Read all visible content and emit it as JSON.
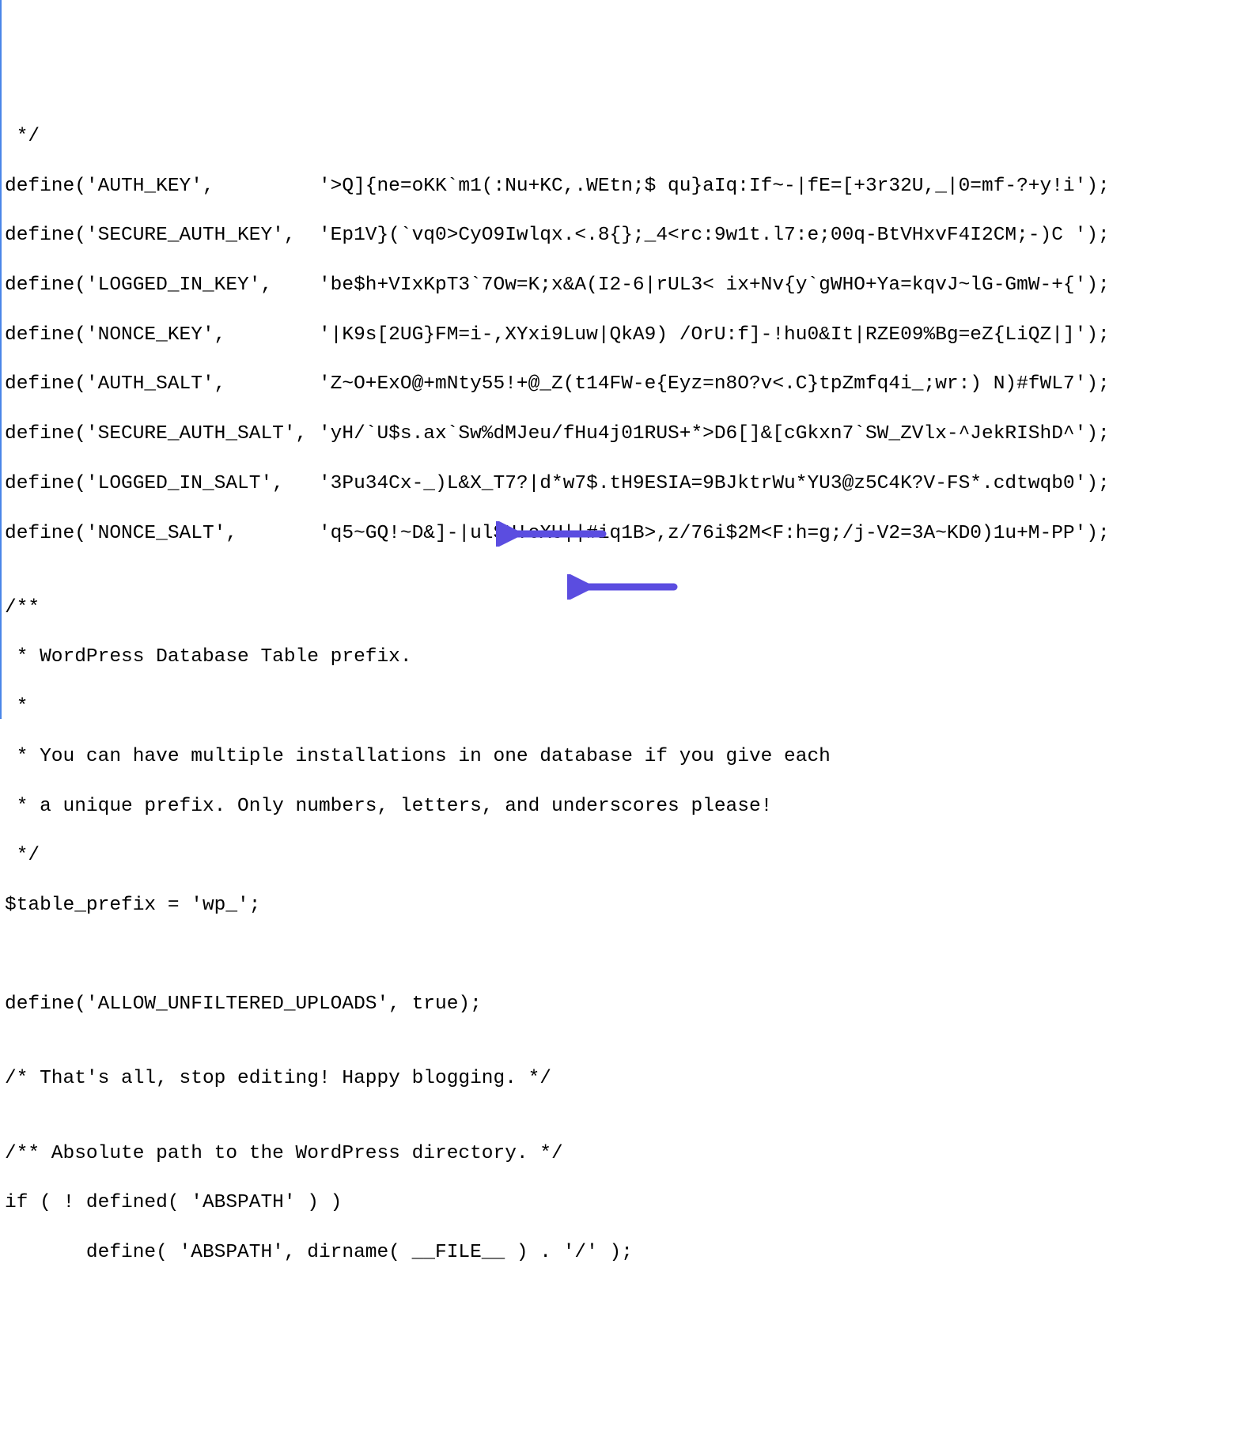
{
  "lines": {
    "l0": " */",
    "l1": "define('AUTH_KEY',         '>Q]{ne=oKK`m1(:Nu+KC,.WEtn;$ qu}aIq:If~-|fE=[+3r32U,_|0=mf-?+y!i');",
    "l2": "define('SECURE_AUTH_KEY',  'Ep1V}(`vq0>CyO9Iwlqx.<.8{};_4<rc:9w1t.l7:e;00q-BtVHxvF4I2CM;-)C ');",
    "l3": "define('LOGGED_IN_KEY',    'be$h+VIxKpT3`7Ow=K;x&A(I2-6|rUL3< ix+Nv{y`gWHO+Ya=kqvJ~lG-GmW-+{');",
    "l4": "define('NONCE_KEY',        '|K9s[2UG}FM=i-,XYxi9Luw|QkA9) /OrU:f]-!hu0&It|RZE09%Bg=eZ{LiQZ|]');",
    "l5": "define('AUTH_SALT',        'Z~O+ExO@+mNty55!+@_Z(t14FW-e{Eyz=n8O?v<.C}tpZmfq4i_;wr:) N)#fWL7');",
    "l6": "define('SECURE_AUTH_SALT', 'yH/`U$s.ax`Sw%dMJeu/fHu4j01RUS+*>D6[]&[cGkxn7`SW_ZVlx-^JekRIShD^');",
    "l7": "define('LOGGED_IN_SALT',   '3Pu34Cx-_)L&X_T7?|d*w7$.tH9ESIA=9BJktrWu*YU3@z5C4K?V-FS*.cdtwqb0');",
    "l8": "define('NONCE_SALT',       'q5~GQ!~D&]-|ulSU!eXU||#iq1B>,z/76i$2M<F:h=g;/j-V2=3A~KD0)1u+M-PP');",
    "l9": "",
    "l10": "/**",
    "l11": " * WordPress Database Table prefix.",
    "l12": " *",
    "l13": " * You can have multiple installations in one database if you give each",
    "l14": " * a unique prefix. Only numbers, letters, and underscores please!",
    "l15": " */",
    "l16": "$table_prefix = 'wp_';",
    "l17": "",
    "l18": "",
    "l19": "define('ALLOW_UNFILTERED_UPLOADS', true);",
    "l20": "",
    "l21": "/* That's all, stop editing! Happy blogging. */",
    "l22": "",
    "l23": "/** Absolute path to the WordPress directory. */",
    "l24": "if ( ! defined( 'ABSPATH' ) )",
    "l25": "       define( 'ABSPATH', dirname( __FILE__ ) . '/' );"
  },
  "arrow_color": "#5b4de0"
}
